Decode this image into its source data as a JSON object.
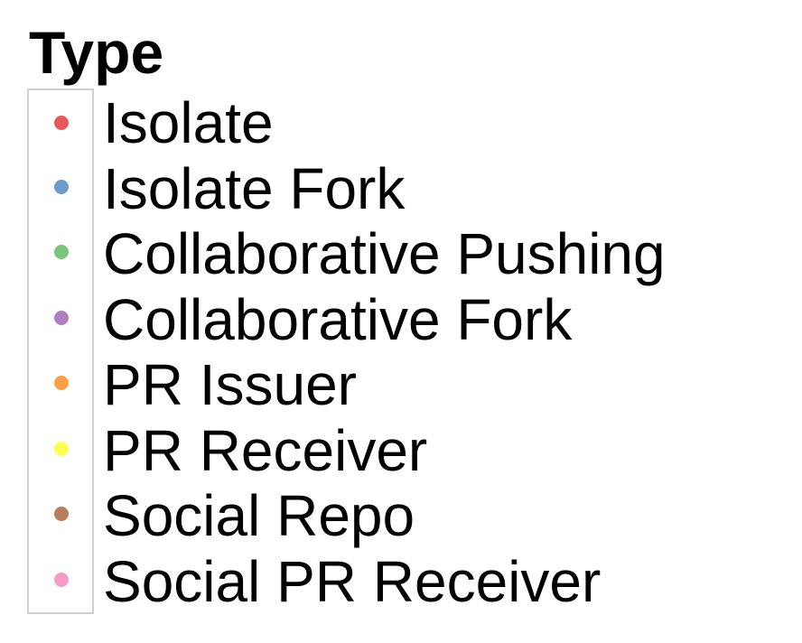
{
  "chart_data": {
    "type": "legend",
    "title": "Type",
    "entries": [
      {
        "label": "Isolate",
        "color": "#E5585C"
      },
      {
        "label": "Isolate Fork",
        "color": "#6D9CCB"
      },
      {
        "label": "Collaborative Pushing",
        "color": "#7CC47A"
      },
      {
        "label": "Collaborative Fork",
        "color": "#B07FC1"
      },
      {
        "label": "PR Issuer",
        "color": "#F9A045"
      },
      {
        "label": "PR Receiver",
        "color": "#FFFF4D"
      },
      {
        "label": "Social Repo",
        "color": "#B67D5E"
      },
      {
        "label": "Social PR Receiver",
        "color": "#F69BC7"
      }
    ]
  }
}
